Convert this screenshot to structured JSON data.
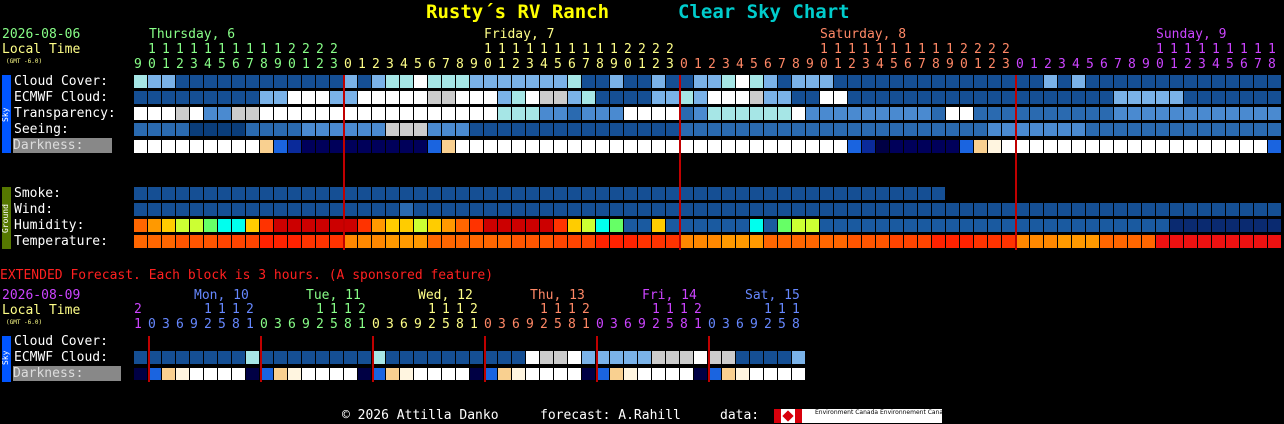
{
  "header": {
    "site_name": "Rusty´s RV Ranch",
    "chart_name": "Clear Sky Chart"
  },
  "main": {
    "date": "2026-08-06",
    "local_time_label": "Local Time",
    "gmt_offset": "(GMT -6.0)",
    "days": [
      {
        "label": "Thursday, 6",
        "color": "#88ff88"
      },
      {
        "label": "Friday, 7",
        "color": "#ffff88"
      },
      {
        "label": "Saturday, 8",
        "color": "#ff8866"
      },
      {
        "label": "Sunday, 9",
        "color": "#cc44ff"
      }
    ],
    "hour_tens": "1 1 1 1 1 1 1 1 1 1 1 1 2 2 2 2",
    "hour_ones": "9 0 1 2 3 4 5 6 7 8 9 0 1 2 3 4 5 6 7 8 9 0 1 2 3",
    "sky_label": "Sky",
    "ground_label": "Ground",
    "rows": [
      {
        "label": "Cloud Cover:"
      },
      {
        "label": "ECMWF Cloud:"
      },
      {
        "label": "Transparency:"
      },
      {
        "label": "Seeing:"
      },
      {
        "label": "Darkness:"
      },
      {
        "label": "Smoke:"
      },
      {
        "label": "Wind:"
      },
      {
        "label": "Humidity:"
      },
      {
        "label": "Temperature:"
      }
    ]
  },
  "extended": {
    "banner": "EXTENDED Forecast. Each block is 3 hours. (A sponsored feature)",
    "date": "2026-08-09",
    "local_time_label": "Local Time",
    "gmt_offset": "(GMT -6.0)",
    "days": [
      {
        "label": "Mon, 10",
        "color": "#6688ff"
      },
      {
        "label": "Tue, 11",
        "color": "#88ff88"
      },
      {
        "label": "Wed, 12",
        "color": "#ffff88"
      },
      {
        "label": "Thu, 13",
        "color": "#ff8866"
      },
      {
        "label": "Fri, 14",
        "color": "#cc44ff"
      },
      {
        "label": "Sat, 15",
        "color": "#6688ff"
      }
    ],
    "hour_tens": "2   1 1 1 2",
    "hour_ones": "1 0 3 6 9 2 5 8",
    "rows": [
      {
        "label": "Cloud Cover:"
      },
      {
        "label": "ECMWF Cloud:"
      },
      {
        "label": "Darkness:"
      }
    ]
  },
  "footer": {
    "copyright": "© 2026 Attilla Danko",
    "forecast": "forecast: A.Rahill",
    "data_label": "data:",
    "logo_text_1": "Environment Canada",
    "logo_text_2": "Environnement Canada"
  },
  "colors": {
    "title": "#ffff00",
    "chart_name": "#00cccc",
    "date": "#88ff88",
    "local_time": "#ffff88",
    "extended_banner": "#ff2020",
    "ext_date": "#cc44ff",
    "sky_bar": "#0055ff",
    "ground_bar": "#557700",
    "red_line": "#c00000"
  }
}
